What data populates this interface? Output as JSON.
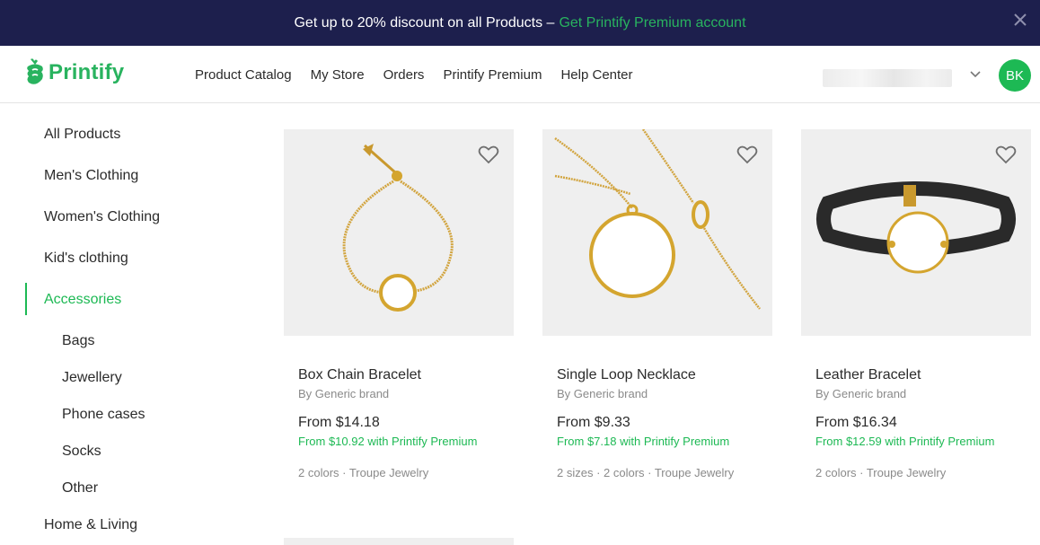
{
  "banner": {
    "text": "Get up to 20% discount on all Products –",
    "link": "Get Printify Premium account",
    "close_icon": "close-icon"
  },
  "header": {
    "logo_text": "Printify",
    "nav": [
      "Product Catalog",
      "My Store",
      "Orders",
      "Printify Premium",
      "Help Center"
    ],
    "avatar_initials": "BK",
    "colors": {
      "brand": "#29b35f",
      "banner_bg": "#1d1f4d",
      "avatar": "#1db954"
    }
  },
  "sidebar": {
    "categories": {
      "all": "All Products",
      "men": "Men's Clothing",
      "women": "Women's Clothing",
      "kids": "Kid's clothing",
      "accessories": "Accessories",
      "home": "Home & Living"
    },
    "active": "Accessories",
    "subcategories": [
      "Bags",
      "Jewellery",
      "Phone cases",
      "Socks",
      "Other"
    ]
  },
  "products": [
    {
      "name": "Box Chain Bracelet",
      "brand": "By Generic brand",
      "price": "From $14.18",
      "premium_price": "From $10.92 with Printify Premium",
      "meta": "2 colors · Troupe Jewelry"
    },
    {
      "name": "Single Loop Necklace",
      "brand": "By Generic brand",
      "price": "From $9.33",
      "premium_price": "From $7.18 with Printify Premium",
      "meta": "2 sizes · 2 colors · Troupe Jewelry"
    },
    {
      "name": "Leather Bracelet",
      "brand": "By Generic brand",
      "price": "From $16.34",
      "premium_price": "From $12.59 with Printify Premium",
      "meta": "2 colors · Troupe Jewelry"
    }
  ]
}
